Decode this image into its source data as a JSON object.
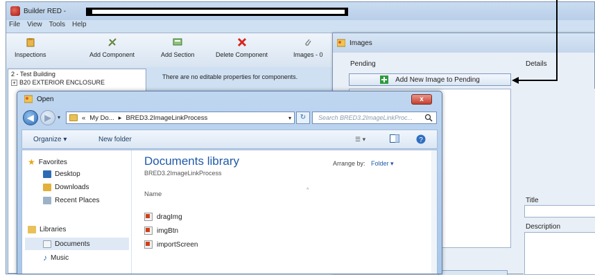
{
  "app": {
    "title": "Builder RED -",
    "menu": [
      "File",
      "View",
      "Tools",
      "Help"
    ],
    "toolbar": {
      "inspections": "Inspections",
      "add_component": "Add Component",
      "add_section": "Add Section",
      "delete_component": "Delete Component",
      "images": "Images - 0"
    },
    "tree": {
      "building": "2 - Test Building",
      "node": "B20 EXTERIOR ENCLOSURE"
    },
    "properties_message": "There are no editable properties for components."
  },
  "images_dialog": {
    "title": "Images",
    "pending_label": "Pending",
    "details_label": "Details",
    "add_button": "Add New Image to Pending",
    "title_label": "Title",
    "description_label": "Description"
  },
  "open_dialog": {
    "title": "Open",
    "close_label": "x",
    "breadcrumb": {
      "prefix": "«",
      "parent": "My Do...",
      "separator": "▸",
      "current": "BRED3.2ImageLinkProcess"
    },
    "search_placeholder": "Search BRED3.2ImageLinkProc...",
    "commands": {
      "organize": "Organize ▾",
      "new_folder": "New folder"
    },
    "nav": {
      "favorites": "Favorites",
      "desktop": "Desktop",
      "downloads": "Downloads",
      "recent_places": "Recent Places",
      "libraries": "Libraries",
      "documents": "Documents",
      "music": "Music"
    },
    "library": {
      "title": "Documents library",
      "path": "BRED3.2ImageLinkProcess",
      "arrange_by_label": "Arrange by:",
      "arrange_by_value": "Folder ▾",
      "column_name": "Name"
    },
    "files": [
      "dragImg",
      "imgBtn",
      "importScreen"
    ]
  },
  "colors": {
    "accent_blue": "#1f5aa8",
    "close_red": "#c44030",
    "add_green": "#2e9b3a",
    "annotation": "#000000"
  }
}
